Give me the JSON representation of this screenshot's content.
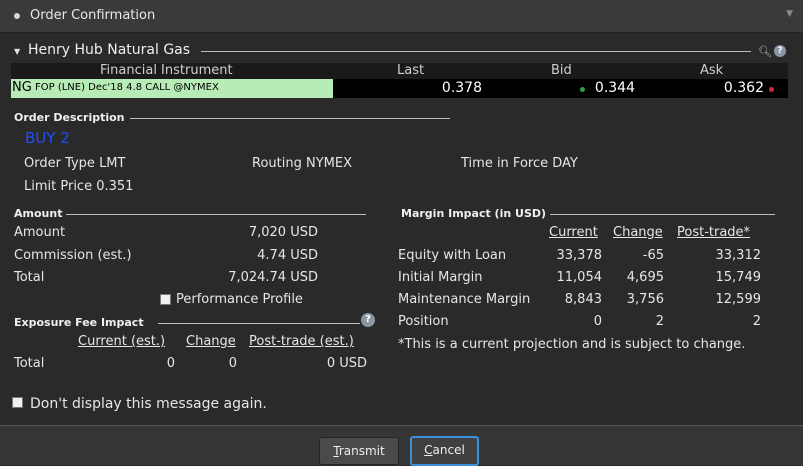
{
  "window": {
    "title": "Order Confirmation"
  },
  "panel": {
    "title": "Henry Hub Natural Gas"
  },
  "instrument_table": {
    "headers": {
      "instrument": "Financial Instrument",
      "last": "Last",
      "bid": "Bid",
      "ask": "Ask"
    },
    "row": {
      "symbol": "NG",
      "description": "FOP (LNE) Dec'18 4.8 CALL @NYMEX",
      "last": "0.378",
      "bid": "0.344",
      "ask": "0.362"
    },
    "colors": {
      "instrument_bg": "#b8ecb6",
      "bid_dot": "#2ea043",
      "ask_dot": "#d42a2a"
    }
  },
  "order_description": {
    "title": "Order Description",
    "action": "BUY 2",
    "order_type": "Order Type LMT",
    "routing": "Routing NYMEX",
    "tif": "Time in Force DAY",
    "limit_price": "Limit Price  0.351",
    "action_color": "#1e4fff"
  },
  "amount": {
    "title": "Amount",
    "rows": [
      {
        "label": "Amount",
        "value": "7,020 USD"
      },
      {
        "label": "Commission (est.)",
        "value": "4.74 USD"
      },
      {
        "label": "Total",
        "value": "7,024.74 USD"
      }
    ],
    "performance_profile": "Performance Profile"
  },
  "exposure": {
    "title": "Exposure Fee Impact",
    "headers": {
      "current": "Current (est.)",
      "change": "Change",
      "post": "Post-trade (est.)"
    },
    "row": {
      "label": "Total",
      "current": "0",
      "change": "0",
      "post": "0 USD"
    }
  },
  "margin": {
    "title": "Margin Impact (in USD)",
    "headers": {
      "current": "Current",
      "change": "Change",
      "post": "Post-trade*"
    },
    "rows": [
      {
        "label": "Equity with Loan",
        "current": "33,378",
        "change": "-65",
        "post": "33,312"
      },
      {
        "label": "Initial Margin",
        "current": "11,054",
        "change": "4,695",
        "post": "15,749"
      },
      {
        "label": "Maintenance Margin",
        "current": "8,843",
        "change": "3,756",
        "post": "12,599"
      },
      {
        "label": "Position",
        "current": "0",
        "change": "2",
        "post": "2"
      }
    ],
    "note": "*This is a current projection and is subject to change."
  },
  "dont_display": "Don't display this message again.",
  "buttons": {
    "transmit_accel": "T",
    "transmit_rest": "ransmit",
    "cancel_accel": "C",
    "cancel_rest": "ancel"
  }
}
